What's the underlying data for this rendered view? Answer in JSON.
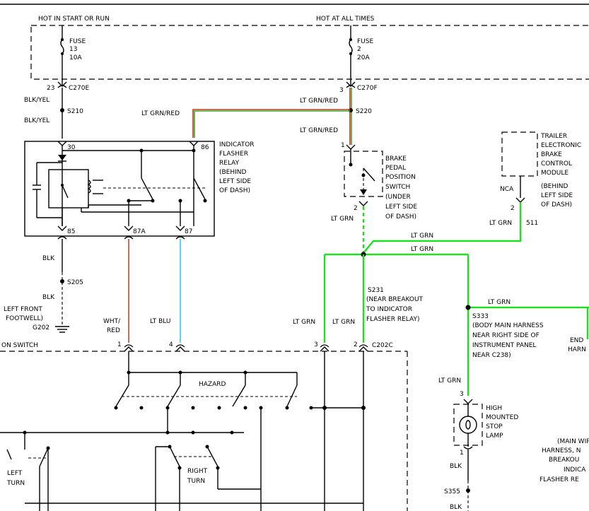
{
  "colors": {
    "lt_grn": "#22dd22",
    "lt_blu": "#33ccee",
    "wht_red": "#cc4433",
    "lt_grn_red_a": "#cc3322",
    "lt_grn_red_b": "#33aa22"
  },
  "power": {
    "left_header": "HOT IN START OR RUN",
    "center_header": "HOT AT ALL TIMES",
    "fuse13_label": "FUSE",
    "fuse13_num": "13",
    "fuse13_rating": "10A",
    "fuse2_label": "FUSE",
    "fuse2_num": "2",
    "fuse2_rating": "20A"
  },
  "connectors": {
    "c270e_pin": "23",
    "c270e": "C270E",
    "c270f_pin": "3",
    "c270f": "C270F",
    "c202c": "C202C",
    "pin1": "1",
    "pin4": "4",
    "pin3": "3",
    "pin2": "2"
  },
  "splices": {
    "s210": "S210",
    "s220": "S220",
    "s205": "S205",
    "s231": "S231",
    "s231_desc": [
      "(NEAR BREAKOUT",
      "TO INDICATOR",
      "FLASHER RELAY)"
    ],
    "s333": "S333",
    "s333_desc": [
      "(BODY MAIN HARNESS",
      "NEAR RIGHT SIDE OF",
      "INSTRUMENT PANEL",
      "NEAR C238)"
    ],
    "s355": "S355"
  },
  "wires": {
    "blk_yel": "BLK/YEL",
    "lt_grn_red": "LT GRN/RED",
    "blk": "BLK",
    "lt_grn": "LT GRN",
    "wht_red_1": "WHT/",
    "wht_red_2": "RED",
    "lt_blu": "LT BLU",
    "circuit_511": "511"
  },
  "relay": {
    "title": [
      "INDICATOR",
      "FLASHER",
      "RELAY",
      "(BEHIND",
      "LEFT SIDE",
      "OF DASH)"
    ],
    "pin30": "30",
    "pin86": "86",
    "pin85": "85",
    "pin87a": "87A",
    "pin87": "87"
  },
  "brake_switch": {
    "pin1": "1",
    "pin2": "2",
    "label": [
      "BRAKE",
      "PEDAL",
      "POSITION",
      "SWITCH",
      "(UNDER",
      "LEFT SIDE",
      "OF DASH)"
    ]
  },
  "trailer_module": {
    "label": [
      "TRAILER",
      "ELECTRONIC",
      "BRAKE",
      "CONTROL",
      "MODULE",
      "(BEHIND",
      "LEFT SIDE",
      "OF DASH)"
    ],
    "nca": "NCA",
    "pin": "2"
  },
  "ground": {
    "location": [
      "LEFT FRONT",
      "FOOTWELL)"
    ],
    "id": "G202"
  },
  "ignition_switch": "ON SWITCH",
  "hazard": "HAZARD",
  "left_turn": [
    "LEFT",
    "TURN"
  ],
  "right_turn": [
    "RIGHT",
    "TURN"
  ],
  "stop_lamp": {
    "pin3": "3",
    "pin1": "1",
    "label": [
      "HIGH",
      "MOUNTED",
      "STOP",
      "LAMP"
    ]
  },
  "right_edge": {
    "end_label": [
      "END",
      "HARN"
    ],
    "main_note": [
      "(MAIN WIR",
      "HARNESS, N",
      "BREAKOU",
      "INDICA",
      "FLASHER RE"
    ]
  }
}
